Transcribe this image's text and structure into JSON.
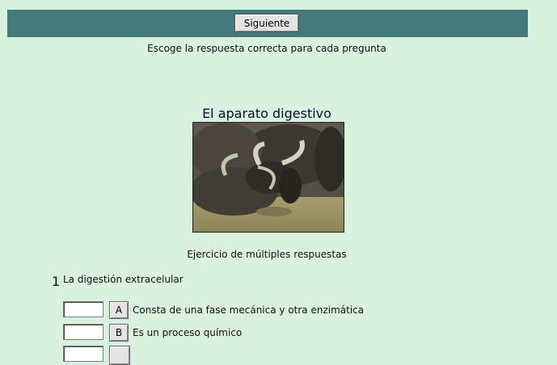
{
  "toolbar": {
    "next_label": "Siguiente"
  },
  "instructions": "Escoge la respuesta correcta para cada pregunta",
  "title": "El aparato digestivo",
  "subtitle": "Ejercicio de múltiples respuestas",
  "question": {
    "number": "1",
    "text": "La digestión extracelular",
    "answers": [
      {
        "letter": "A",
        "text": "Consta de una fase mecánica y otra enzimática",
        "value": ""
      },
      {
        "letter": "B",
        "text": "Es un proceso químico",
        "value": ""
      }
    ]
  },
  "colors": {
    "background": "#d9f2dd",
    "toolbar": "#457a7d"
  }
}
